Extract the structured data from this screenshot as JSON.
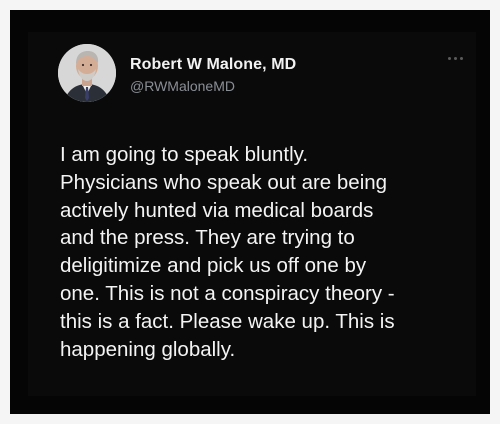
{
  "author": {
    "name": "Robert W Malone, MD",
    "handle": "@RWMaloneMD",
    "avatar_icon": "profile-photo"
  },
  "tweet": {
    "text": "I am going to speak bluntly.\nPhysicians who speak out are being\nactively hunted via medical boards\nand the press.  They are trying to\ndeligitimize and pick us off one by\none.  This is not a conspiracy theory -\nthis is a fact. Please wake up. This is\nhappening globally."
  },
  "menu": {
    "icon": "more-options-icon"
  },
  "colors": {
    "background": "#050505",
    "name": "#f2f2f2",
    "handle": "#8a8f96",
    "text": "#f4f4f4"
  }
}
